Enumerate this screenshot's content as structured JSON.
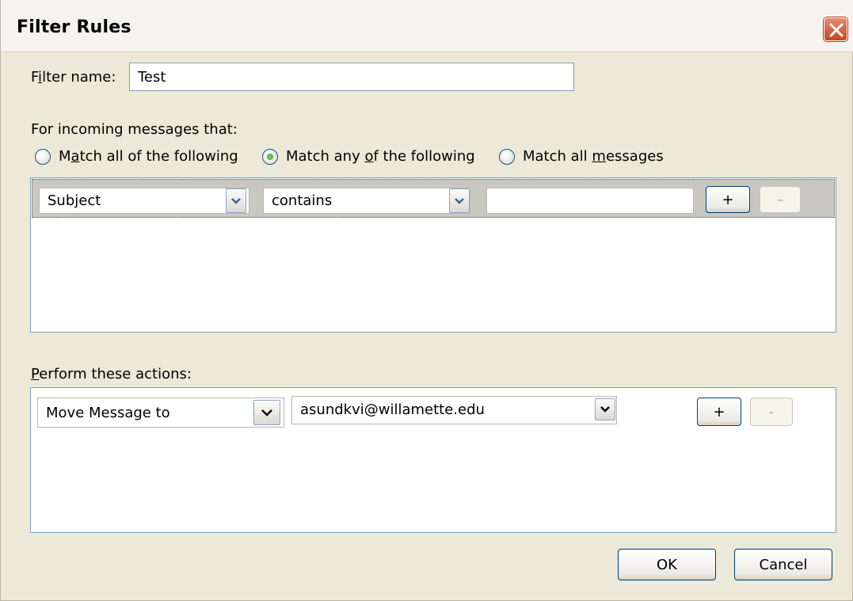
{
  "window": {
    "title": "Filter Rules",
    "close_icon": "close-icon"
  },
  "filter_name": {
    "label_pre": "F",
    "label_mnemonic": "i",
    "label_post": "lter name:",
    "value": "Test"
  },
  "incoming": {
    "label": "For incoming messages that:",
    "options": [
      {
        "pre": "M",
        "mnemonic": "a",
        "post": "tch all of the following",
        "checked": false
      },
      {
        "pre": "Match any ",
        "mnemonic": "o",
        "post": "f the following",
        "checked": true
      },
      {
        "pre": "Match all ",
        "mnemonic": "m",
        "post": "essages",
        "checked": false
      }
    ]
  },
  "conditions": [
    {
      "field": "Subject",
      "operator": "contains",
      "value": "",
      "add_label": "+",
      "remove_label": "–"
    }
  ],
  "actions_section": {
    "label_mnemonic": "P",
    "label_post": "erform these actions:"
  },
  "actions": [
    {
      "action": "Move Message to",
      "target": "asundkvi@willamette.edu",
      "add_label": "+",
      "remove_label": "-"
    }
  ],
  "footer": {
    "ok_label": "OK",
    "cancel_label": "Cancel"
  },
  "colors": {
    "accent": "#003c74",
    "close_button": "#c64524",
    "radio_checked": "#2a9a21"
  }
}
